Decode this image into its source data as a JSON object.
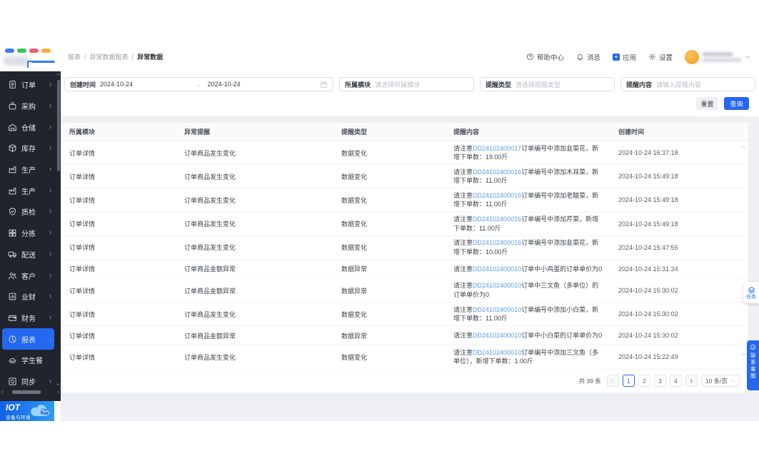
{
  "colors": {
    "accent": "#2468f2",
    "link": "#5b9ce0",
    "sidebar_bg": "#20242c",
    "content_bg": "#eef0f4",
    "avatar": "#f59e25",
    "logo_bars": [
      "#3b7df6",
      "#34c759",
      "#ee5f6e",
      "#f6b23c"
    ]
  },
  "breadcrumb": {
    "items": [
      "报表",
      "异常数据报表"
    ],
    "current": "异常数据",
    "sep": "/"
  },
  "header": {
    "help": "帮助中心",
    "messages": "消息",
    "apps": "应用",
    "settings": "设置"
  },
  "sidebar": {
    "items": [
      {
        "name": "orders",
        "label": "订单",
        "icon": "order-icon",
        "arrow": true,
        "active": false
      },
      {
        "name": "purchase",
        "label": "采购",
        "icon": "purchase-icon",
        "arrow": true,
        "active": false
      },
      {
        "name": "warehouse",
        "label": "仓储",
        "icon": "warehouse-icon",
        "arrow": true,
        "active": false
      },
      {
        "name": "inventory",
        "label": "库存",
        "icon": "inventory-icon",
        "arrow": true,
        "active": false
      },
      {
        "name": "production-1",
        "label": "生产",
        "icon": "production-icon",
        "arrow": true,
        "active": false
      },
      {
        "name": "production-2",
        "label": "生产",
        "icon": "production-icon",
        "arrow": true,
        "active": false
      },
      {
        "name": "quality",
        "label": "质检",
        "icon": "quality-icon",
        "arrow": true,
        "active": false
      },
      {
        "name": "sorting",
        "label": "分拣",
        "icon": "sorting-icon",
        "arrow": true,
        "active": false
      },
      {
        "name": "delivery",
        "label": "配送",
        "icon": "delivery-icon",
        "arrow": true,
        "active": false
      },
      {
        "name": "customers",
        "label": "客户",
        "icon": "customer-icon",
        "arrow": true,
        "active": false
      },
      {
        "name": "business-finance",
        "label": "业财",
        "icon": "bizchart-icon",
        "arrow": true,
        "active": false
      },
      {
        "name": "finance",
        "label": "财务",
        "icon": "finance-icon",
        "arrow": true,
        "active": false
      },
      {
        "name": "reports",
        "label": "报表",
        "icon": "report-icon",
        "arrow": true,
        "active": true
      },
      {
        "name": "student-meal",
        "label": "学生餐",
        "icon": "meal-icon",
        "arrow": false,
        "active": false
      },
      {
        "name": "sync",
        "label": "同步",
        "icon": "sync-icon",
        "arrow": true,
        "active": false
      }
    ],
    "bottom_logo": {
      "title": "IOT",
      "subtitle": "设备与环境"
    }
  },
  "filters": {
    "date": {
      "label": "创建时间",
      "start": "2024-10-24",
      "arrow": "→",
      "end": "2024-10-24"
    },
    "module": {
      "label": "所属模块",
      "placeholder": "请选择所属模块"
    },
    "type": {
      "label": "提醒类型",
      "placeholder": "请选择提醒类型"
    },
    "content": {
      "label": "提醒内容",
      "placeholder": "请输入提醒内容"
    },
    "reset": "重置",
    "search": "查询"
  },
  "table": {
    "columns": [
      "所属模块",
      "异常提醒",
      "提醒类型",
      "提醒内容",
      "创建时间"
    ],
    "rows": [
      {
        "module": "订单详情",
        "alert": "订单商品发生变化",
        "type": "数据变化",
        "content_prefix": "请注意",
        "order_no": "DD24102400017",
        "content_suffix": "订单编号中添加韭菜花，新增下单数：19.00斤",
        "created_at": "2024-10-24 16:37:18"
      },
      {
        "module": "订单详情",
        "alert": "订单商品发生变化",
        "type": "数据变化",
        "content_prefix": "请注意",
        "order_no": "DD24102400016",
        "content_suffix": "订单编号中添加木耳菜，新增下单数：11.00斤",
        "created_at": "2024-10-24 15:49:18"
      },
      {
        "module": "订单详情",
        "alert": "订单商品发生变化",
        "type": "数据变化",
        "content_prefix": "请注意",
        "order_no": "DD24102400016",
        "content_suffix": "订单编号中添加老酸菜，新增下单数：11.00斤",
        "created_at": "2024-10-24 15:49:18"
      },
      {
        "module": "订单详情",
        "alert": "订单商品发生变化",
        "type": "数据变化",
        "content_prefix": "请注意",
        "order_no": "DD24102400016",
        "content_suffix": "订单编号中添加芹菜，新增下单数：11.00斤",
        "created_at": "2024-10-24 15:49:18"
      },
      {
        "module": "订单详情",
        "alert": "订单商品发生变化",
        "type": "数据变化",
        "content_prefix": "请注意",
        "order_no": "DD24102400016",
        "content_suffix": "订单编号中添加韭菜花，新增下单数：10.00斤",
        "created_at": "2024-10-24 15:47:55"
      },
      {
        "module": "订单详情",
        "alert": "订单商品金额异常",
        "type": "数据异常",
        "content_prefix": "请注意",
        "order_no": "DD24102400010",
        "content_suffix": "订单中小鸡蛋的订单单价为0",
        "created_at": "2024-10-24 15:31:34"
      },
      {
        "module": "订单详情",
        "alert": "订单商品金额异常",
        "type": "数据异常",
        "content_prefix": "请注意",
        "order_no": "DD24102400010",
        "content_suffix": "订单中三文鱼（多单位）的订单单价为0",
        "created_at": "2024-10-24 15:30:02"
      },
      {
        "module": "订单详情",
        "alert": "订单商品发生变化",
        "type": "数据变化",
        "content_prefix": "请注意",
        "order_no": "DD24102400010",
        "content_suffix": "订单编号中添加小白菜，新增下单数：11.00斤",
        "created_at": "2024-10-24 15:30:02"
      },
      {
        "module": "订单详情",
        "alert": "订单商品金额异常",
        "type": "数据异常",
        "content_prefix": "请注意",
        "order_no": "DD24102400010",
        "content_suffix": "订单中小白菜的订单单价为0",
        "created_at": "2024-10-24 15:30:02"
      },
      {
        "module": "订单详情",
        "alert": "订单商品发生变化",
        "type": "数据变化",
        "content_prefix": "请注意",
        "order_no": "DD24102400010",
        "content_suffix": "订单编号中添加三文鱼（多单位），新增下单数：1.00斤",
        "created_at": "2024-10-24 15:22:49"
      }
    ]
  },
  "pagination": {
    "total_label": "共 39 条",
    "pages": [
      "1",
      "2",
      "3",
      "4"
    ],
    "active_index": 0,
    "page_size": "10 条/页"
  },
  "floating": {
    "task_label": "任务",
    "service_label": "联系客服"
  }
}
